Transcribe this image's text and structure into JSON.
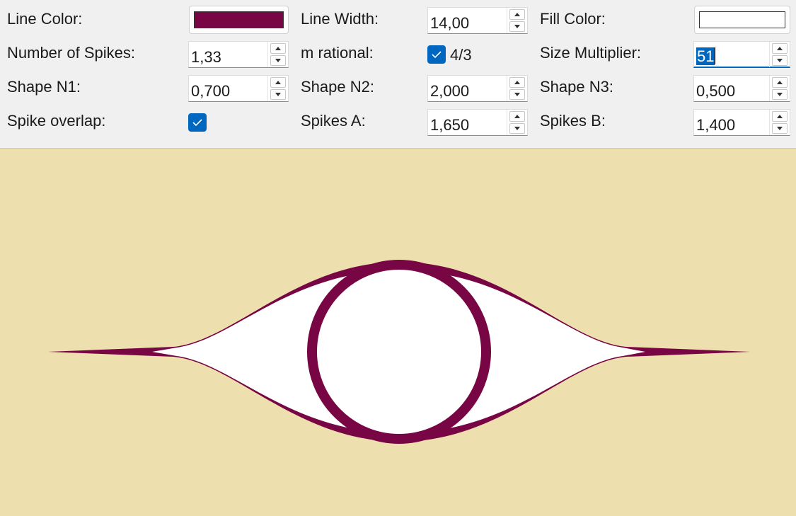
{
  "controls": {
    "line_color_label": "Line Color:",
    "line_width_label": "Line Width:",
    "line_width_value": "14,00",
    "fill_color_label": "Fill Color:",
    "num_spikes_label": "Number of Spikes:",
    "num_spikes_value": "1,33",
    "m_rational_label": "m rational:",
    "m_rational_checked": true,
    "m_rational_fraction": "4/3",
    "size_multiplier_label": "Size Multiplier:",
    "size_multiplier_value": "51",
    "shape_n1_label": "Shape N1:",
    "shape_n1_value": "0,700",
    "shape_n2_label": "Shape N2:",
    "shape_n2_value": "2,000",
    "shape_n3_label": "Shape N3:",
    "shape_n3_value": "0,500",
    "spike_overlap_label": "Spike overlap:",
    "spike_overlap_checked": true,
    "spikes_a_label": "Spikes A:",
    "spikes_a_value": "1,650",
    "spikes_b_label": "Spikes B:",
    "spikes_b_value": "1,400"
  },
  "colors": {
    "line_color": "#780644",
    "fill_color": "#ffffff",
    "canvas_background": "#eedfae",
    "accent": "#0067c0"
  },
  "icons": {
    "checkbox": "check-icon",
    "spin_up": "chevron-up-icon",
    "spin_down": "chevron-down-icon"
  }
}
